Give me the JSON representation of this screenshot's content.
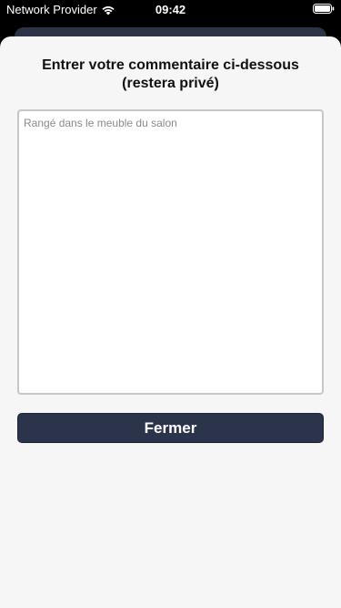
{
  "status_bar": {
    "carrier": "Network Provider",
    "time": "09:42",
    "wifi_icon": "wifi-icon",
    "battery_icon": "battery-icon"
  },
  "sheet": {
    "title_line1": "Entrer votre commentaire ci-dessous",
    "title_line2": "(restera privé)",
    "comment_placeholder": "Rangé dans le meuble du salon",
    "close_label": "Fermer"
  },
  "colors": {
    "sheet_background": "#f6f6f6",
    "button_background": "#2b344a",
    "status_bar_background": "#000000"
  }
}
